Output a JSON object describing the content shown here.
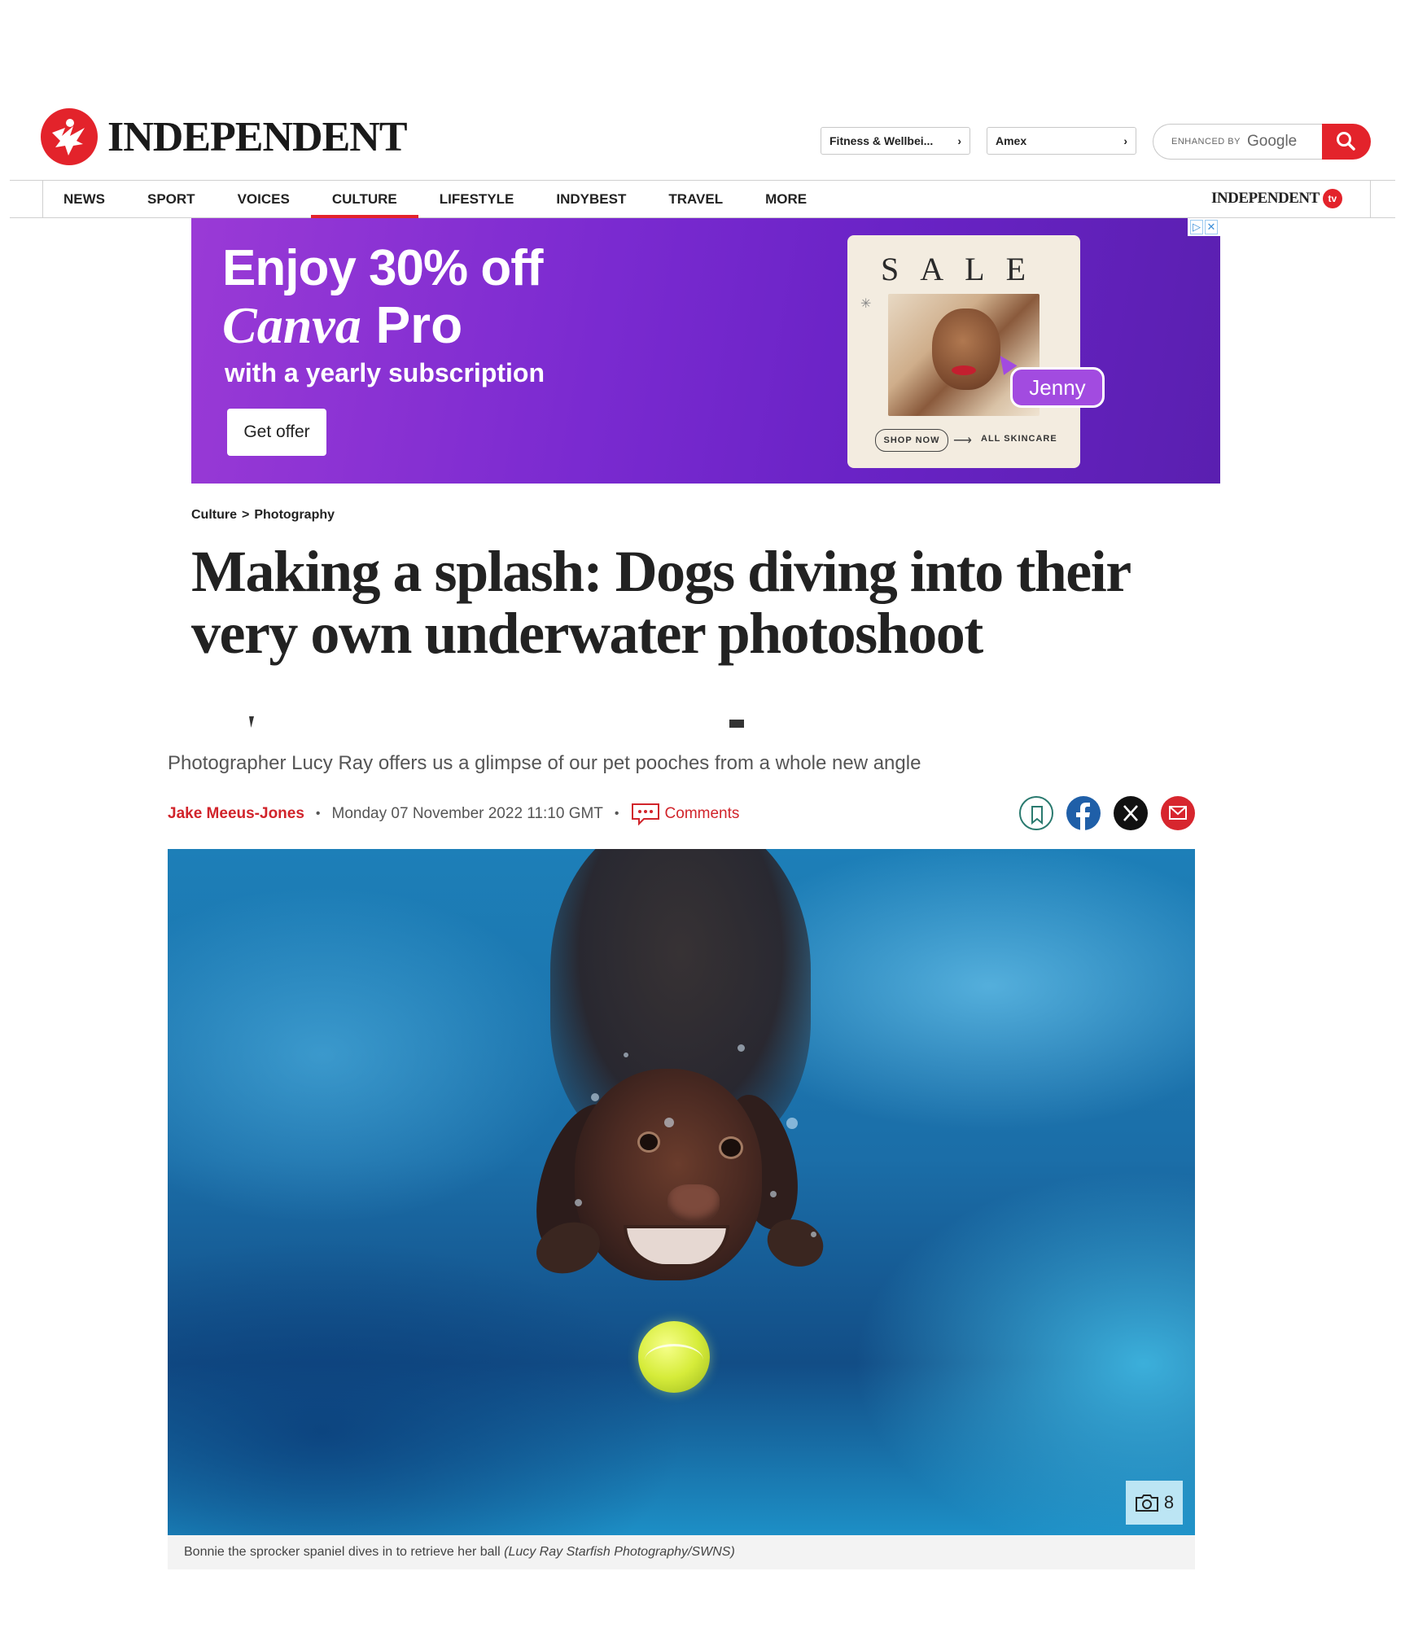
{
  "brand": {
    "name": "INDEPENDENT",
    "tv_label": "INDEPENDENT",
    "tv_badge": "tv"
  },
  "header": {
    "selects": [
      {
        "label": "Fitness & Wellbei...",
        "chevron": "›"
      },
      {
        "label": "Amex",
        "chevron": "›"
      }
    ],
    "search": {
      "enhanced_by": "ENHANCED BY",
      "provider": "Google"
    }
  },
  "nav": {
    "items": [
      {
        "label": "NEWS"
      },
      {
        "label": "SPORT"
      },
      {
        "label": "VOICES"
      },
      {
        "label": "CULTURE",
        "active": true
      },
      {
        "label": "LIFESTYLE"
      },
      {
        "label": "INDYBEST"
      },
      {
        "label": "TRAVEL"
      },
      {
        "label": "MORE"
      }
    ]
  },
  "ad": {
    "line1": "Enjoy 30% off",
    "line2_brand": "Canva",
    "line2_product": "Pro",
    "line3": "with a yearly subscription",
    "cta": "Get offer",
    "card_title": "SALE",
    "card_tag": "Jenny",
    "card_shop": "SHOP NOW",
    "card_arrow": "⟶",
    "card_category": "ALL SKINCARE",
    "choices_icon": "▷",
    "close_icon": "✕",
    "colors": {
      "gradient_start": "#9a3ad6",
      "gradient_end": "#5a1fb0",
      "tag": "#a24be0"
    }
  },
  "article": {
    "breadcrumb": {
      "section": "Culture",
      "separator": ">",
      "subsection": "Photography"
    },
    "headline": "Making a splash: Dogs diving into their very own underwater photoshoot",
    "standfirst": "Photographer Lucy Ray offers us a glimpse of our pet pooches from a whole new angle",
    "author": "Jake Meeus-Jones",
    "date": "Monday 07 November 2022 11:10 GMT",
    "comments_label": "Comments",
    "share": [
      "bookmark-icon",
      "facebook-icon",
      "x-icon",
      "email-icon"
    ],
    "image": {
      "gallery_count": "8",
      "caption": "Bonnie the sprocker spaniel dives in to retrieve her ball",
      "credit": "(Lucy Ray Starfish Photography/SWNS)"
    }
  },
  "colors": {
    "accent": "#e3232b",
    "author": "#d1242b",
    "text": "#222222"
  }
}
